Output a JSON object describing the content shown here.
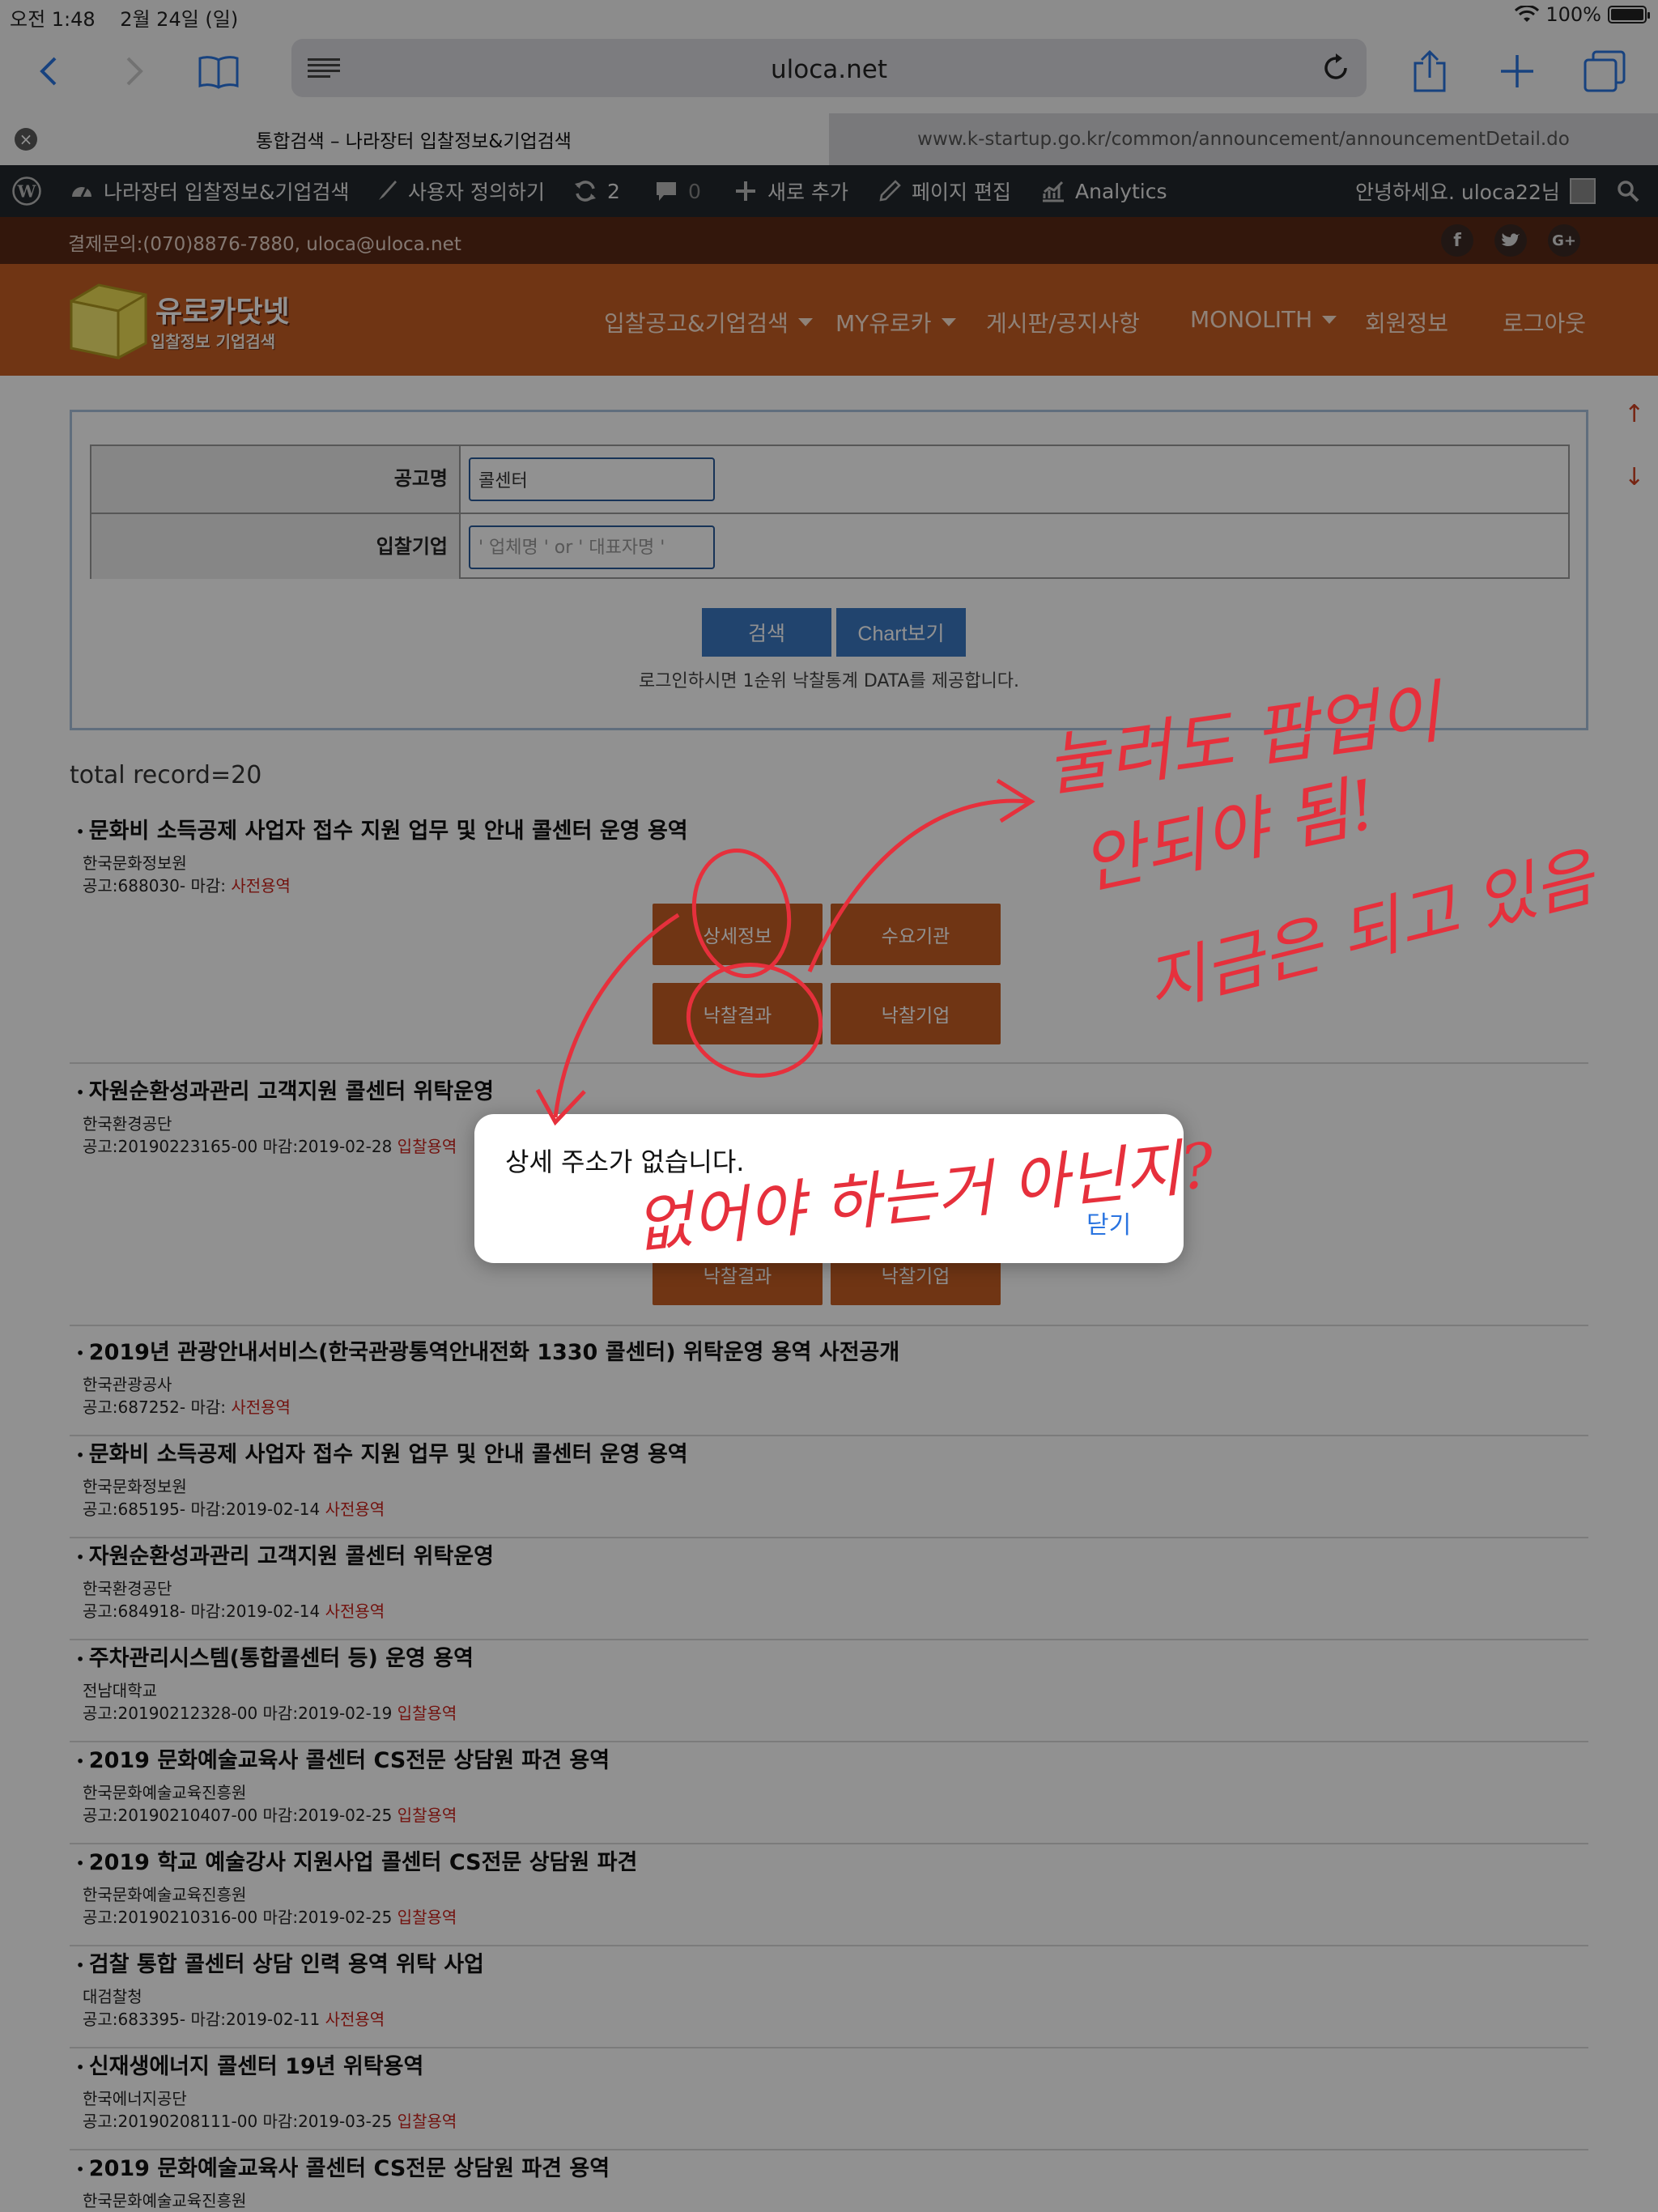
{
  "status": {
    "time": "오전 1:48",
    "date": "2월 24일 (일)",
    "battery_percent": "100%",
    "battery_level": 1.0
  },
  "browser": {
    "address": "uloca.net",
    "tabs": [
      {
        "label": "통합검색 – 나라장터 입찰정보&기업검색"
      },
      {
        "label": "www.k-startup.go.kr/common/announcement/announcementDetail.do"
      }
    ]
  },
  "wpbar": {
    "site": "나라장터 입찰정보&기업검색",
    "customize": "사용자 정의하기",
    "updates": "2",
    "comments": "0",
    "new": "새로 추가",
    "edit": "페이지 편집",
    "analytics": "Analytics",
    "greeting": "안녕하세요. uloca22님"
  },
  "contact": {
    "text": "결제문의:(070)8876-7880, uloca@uloca.net"
  },
  "header": {
    "logo_title": "유로카닷넷",
    "logo_sub": "입찰정보 기업검색",
    "nav": [
      {
        "label": "입찰공고&기업검색"
      },
      {
        "label": "MY유로카"
      },
      {
        "label": "게시판/공지사항"
      },
      {
        "label": "MONOLITH"
      },
      {
        "label": "회원정보"
      },
      {
        "label": "로그아웃"
      }
    ]
  },
  "search": {
    "title_label": "공고명",
    "title_value": "콜센터",
    "company_label": "입찰기업",
    "company_placeholder": "' 업체명 ' or ' 대표자명 '",
    "search_button": "검색",
    "chart_button": "Chart보기",
    "note": "로그인하시면 1순위 낙찰통계 DATA를 제공합니다."
  },
  "results": {
    "total": "total record=20",
    "buttons": {
      "detail": "상세정보",
      "agency": "수요기관",
      "result": "낙찰결과",
      "winner": "낙찰기업"
    },
    "items": [
      {
        "title": "문화비 소득공제 사업자 접수 지원 업무 및 안내 콜센터 운영 용역",
        "org": "한국문화정보원",
        "meta": "공고:688030- 마감:",
        "type": "사전용역"
      },
      {
        "title": "자원순환성과관리 고객지원 콜센터 위탁운영",
        "org": "한국환경공단",
        "meta": "공고:20190223165-00 마감:2019-02-28",
        "type": "입찰용역"
      },
      {
        "title": "2019년 관광안내서비스(한국관광통역안내전화 1330 콜센터) 위탁운영 용역 사전공개",
        "org": "한국관광공사",
        "meta": "공고:687252- 마감:",
        "type": "사전용역"
      },
      {
        "title": "문화비 소득공제 사업자 접수 지원 업무 및 안내 콜센터 운영 용역",
        "org": "한국문화정보원",
        "meta": "공고:685195- 마감:2019-02-14",
        "type": "사전용역"
      },
      {
        "title": "자원순환성과관리 고객지원 콜센터 위탁운영",
        "org": "한국환경공단",
        "meta": "공고:684918- 마감:2019-02-14",
        "type": "사전용역"
      },
      {
        "title": "주차관리시스템(통합콜센터 등) 운영 용역",
        "org": "전남대학교",
        "meta": "공고:20190212328-00 마감:2019-02-19",
        "type": "입찰용역"
      },
      {
        "title": "2019 문화예술교육사 콜센터 CS전문 상담원 파견 용역",
        "org": "한국문화예술교육진흥원",
        "meta": "공고:20190210407-00 마감:2019-02-25",
        "type": "입찰용역"
      },
      {
        "title": "2019 학교 예술강사 지원사업 콜센터 CS전문 상담원 파견",
        "org": "한국문화예술교육진흥원",
        "meta": "공고:20190210316-00 마감:2019-02-25",
        "type": "입찰용역"
      },
      {
        "title": "검찰 통합 콜센터 상담 인력 용역 위탁 사업",
        "org": "대검찰청",
        "meta": "공고:683395- 마감:2019-02-11",
        "type": "사전용역"
      },
      {
        "title": "신재생에너지 콜센터 19년 위탁용역",
        "org": "한국에너지공단",
        "meta": "공고:20190208111-00 마감:2019-03-25",
        "type": "입찰용역"
      },
      {
        "title": "2019 문화예술교육사 콜센터 CS전문 상담원 파견 용역",
        "org": "한국문화예술교육진흥원",
        "meta": "",
        "type": ""
      }
    ]
  },
  "alert": {
    "message": "상세 주소가 없습니다.",
    "close": "닫기"
  },
  "annotations": {
    "line1": "눌러도 팝업이",
    "line2": "안되야 됨!",
    "line3": "지금은 되고 있음",
    "line4": "없어야 하는거 아닌지?"
  }
}
